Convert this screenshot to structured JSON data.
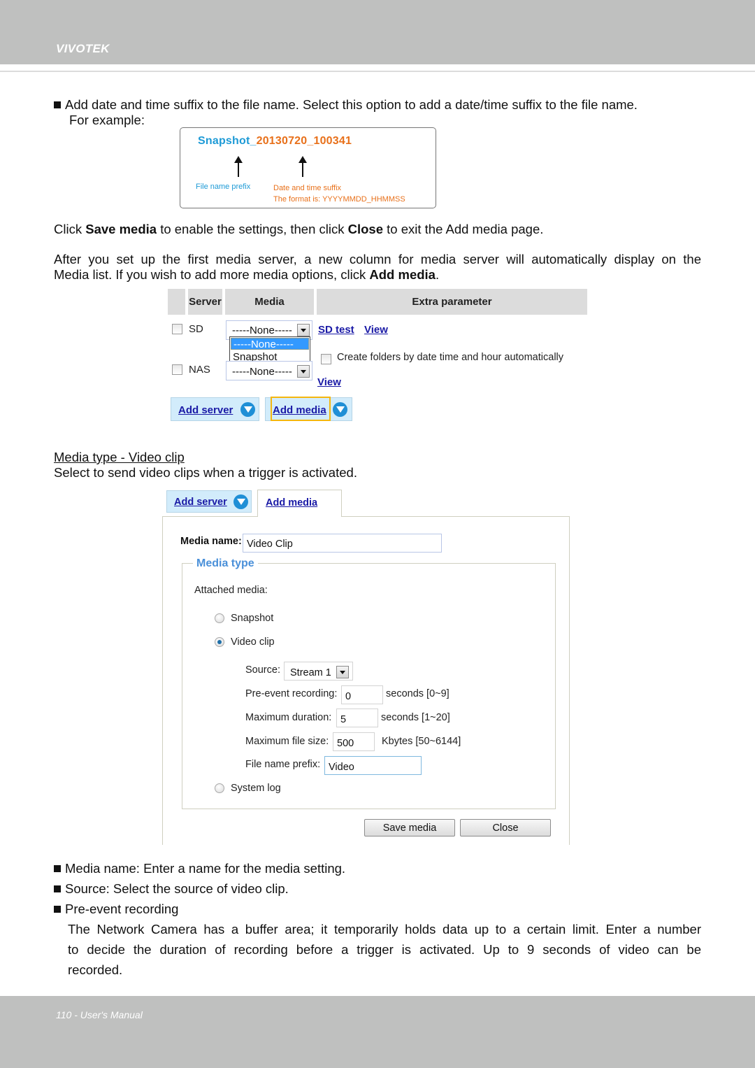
{
  "header": {
    "brand": "VIVOTEK"
  },
  "footer": {
    "page_label": "110 - User's Manual"
  },
  "intro": {
    "bullet_text": "Add date and time suffix to the file name. Select this option to add a date/time suffix to the file name.",
    "for_example": "For example:"
  },
  "example": {
    "prefix": "Snapshot_",
    "suffix": "20130720_100341",
    "prefix_label": "File name prefix",
    "suffix_label": "Date and time suffix",
    "format_label": "The format is: YYYYMMDD_HHMMSS",
    "colors": {
      "prefix": "#1d9ad6",
      "suffix": "#e8701a"
    }
  },
  "para_save": {
    "t1": "Click ",
    "b1": "Save media",
    "t2": " to enable the settings, then click ",
    "b2": "Close",
    "t3": " to exit the Add media page."
  },
  "para_after": {
    "line1": "After you set up the first media server, a new column for media server will automatically display on the",
    "line2_pre": "Media list. If you wish to add more media options, click ",
    "line2_bold": "Add media",
    "line2_post": "."
  },
  "media_list": {
    "columns": [
      "Server",
      "Media",
      "Extra parameter"
    ],
    "rows": [
      {
        "server": "SD",
        "media": "-----None-----",
        "links": [
          "SD test",
          "View"
        ]
      },
      {
        "server": "NAS",
        "media": "-----None-----",
        "option_label": "Create folders by date time and hour automatically",
        "links": [
          "View"
        ]
      }
    ],
    "dropdown_options": [
      "-----None-----",
      "Snapshot"
    ],
    "dropdown_selected": "-----None-----",
    "add_server": "Add server",
    "add_media": "Add media",
    "highlight_color": "#f5b60d"
  },
  "section": {
    "title": "Media type - Video clip",
    "desc": "Select to send video clips when a trigger is activated."
  },
  "form": {
    "tab_add_server": "Add server",
    "tab_add_media": "Add media",
    "media_name_label": "Media name:",
    "media_name_value": "Video Clip",
    "legend": "Media type",
    "attached_media_label": "Attached media:",
    "radio_options": [
      {
        "label": "Snapshot",
        "checked": false
      },
      {
        "label": "Video clip",
        "checked": true
      },
      {
        "label": "System log",
        "checked": false
      }
    ],
    "source_label": "Source:",
    "source_value": "Stream 1",
    "pre_event_label": "Pre-event recording:",
    "pre_event_value": "0",
    "pre_event_unit": "seconds [0~9]",
    "max_duration_label": "Maximum duration:",
    "max_duration_value": "5",
    "max_duration_unit": "seconds [1~20]",
    "max_file_size_label": "Maximum file size:",
    "max_file_size_value": "500",
    "max_file_size_unit": "Kbytes [50~6144]",
    "file_prefix_label": "File name prefix:",
    "file_prefix_value": "Video",
    "save_button": "Save media",
    "close_button": "Close"
  },
  "notes": [
    "Media name: Enter a name for the media setting.",
    "Source: Select the source of video clip.",
    "Pre-event recording"
  ],
  "pre_event_para": {
    "line1": "The Network Camera has a buffer area; it temporarily holds data up to a certain limit. Enter a number",
    "line2": "to decide the duration of recording before a trigger is activated. Up to 9 seconds of video can be",
    "line3": "recorded."
  }
}
